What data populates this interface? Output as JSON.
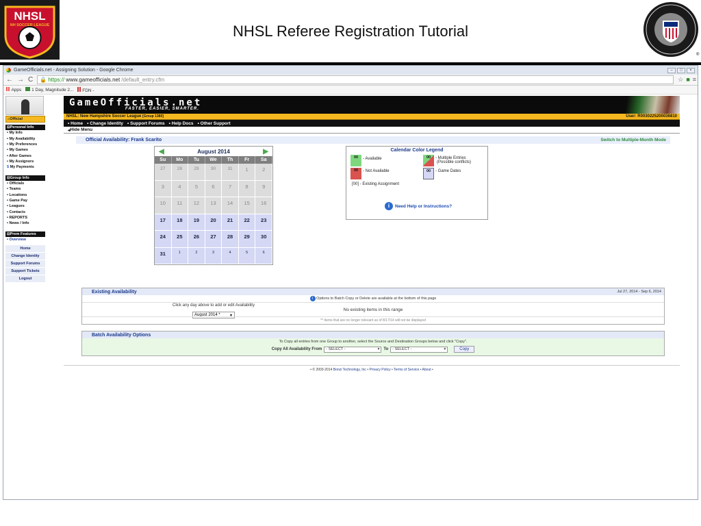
{
  "slide": {
    "title": "NHSL Referee Registration Tutorial",
    "logo_left_text": "NHSL",
    "logo_left_sub": "NH SOCCER LEAGUE",
    "logo_right_text": "U.S. SOCCER FEDERATION REFEREE PROGRAM"
  },
  "browser": {
    "window_title": "GameOfficials.net - Assigning Solution - Google Chrome",
    "url_scheme": "https://",
    "url_host": "www.gameofficials.net",
    "url_path": "/default_entry.cfm",
    "bookmarks": [
      "Apps",
      "1 Day, Magnitude 2...",
      "FDN -"
    ]
  },
  "sidebar": {
    "tab": "Official",
    "personal_head": "Personal Info",
    "personal_items": [
      "My Info",
      "My Availability",
      "My Preferences",
      "My Games",
      "After Games",
      "My Assignors",
      "My Payments"
    ],
    "group_head": "Group Info",
    "group_items": [
      "Officials",
      "Teams",
      "Locations",
      "Game Pay",
      "Leagues",
      "Contacts",
      "REPORTS",
      "News / Info"
    ],
    "prem_head": "Prem Features",
    "prem_items": [
      "Overview"
    ],
    "buttons": [
      "Home",
      "Change Identity",
      "Support Forums",
      "Support Tickets",
      "Logout"
    ]
  },
  "site": {
    "logo": "GameOfficials.net",
    "tagline": "FASTER, EASIER, SMARTER.",
    "org": "NHSL: New Hampshire Soccer League",
    "group": "[Group 1380]",
    "user": "User: R0030225200036810",
    "menu": [
      "Home",
      "Change Identity",
      "Support Forums",
      "Help Docs",
      "Other Support"
    ],
    "hide_menu": "Hide Menu"
  },
  "availability": {
    "heading": "Official Availability:  Frank Scarito",
    "switch_link": "Switch to Multiple-Month Mode"
  },
  "calendar": {
    "month": "August 2014",
    "dow": [
      "Su",
      "Mo",
      "Tu",
      "We",
      "Th",
      "Fr",
      "Sa"
    ],
    "weeks": [
      [
        {
          "d": "27",
          "t": "grey"
        },
        {
          "d": "28",
          "t": "grey"
        },
        {
          "d": "29",
          "t": "grey"
        },
        {
          "d": "30",
          "t": "grey"
        },
        {
          "d": "31",
          "t": "grey"
        },
        {
          "d": "1",
          "t": "grey cur"
        },
        {
          "d": "2",
          "t": "grey cur"
        }
      ],
      [
        {
          "d": "3",
          "t": "grey cur"
        },
        {
          "d": "4",
          "t": "grey cur"
        },
        {
          "d": "5",
          "t": "grey cur"
        },
        {
          "d": "6",
          "t": "grey cur"
        },
        {
          "d": "7",
          "t": "grey cur"
        },
        {
          "d": "8",
          "t": "grey cur"
        },
        {
          "d": "9",
          "t": "grey cur"
        }
      ],
      [
        {
          "d": "10",
          "t": "grey cur"
        },
        {
          "d": "11",
          "t": "grey cur"
        },
        {
          "d": "12",
          "t": "grey cur"
        },
        {
          "d": "13",
          "t": "grey cur"
        },
        {
          "d": "14",
          "t": "grey cur"
        },
        {
          "d": "15",
          "t": "grey cur"
        },
        {
          "d": "16",
          "t": "grey cur"
        }
      ],
      [
        {
          "d": "17",
          "t": "blue"
        },
        {
          "d": "18",
          "t": "blue"
        },
        {
          "d": "19",
          "t": "blue"
        },
        {
          "d": "20",
          "t": "blue"
        },
        {
          "d": "21",
          "t": "blue"
        },
        {
          "d": "22",
          "t": "blue"
        },
        {
          "d": "23",
          "t": "blue"
        }
      ],
      [
        {
          "d": "24",
          "t": "blue"
        },
        {
          "d": "25",
          "t": "blue"
        },
        {
          "d": "26",
          "t": "blue"
        },
        {
          "d": "27",
          "t": "blue"
        },
        {
          "d": "28",
          "t": "blue"
        },
        {
          "d": "29",
          "t": "blue"
        },
        {
          "d": "30",
          "t": "blue"
        }
      ],
      [
        {
          "d": "31",
          "t": "blue"
        },
        {
          "d": "1",
          "t": "blue small"
        },
        {
          "d": "2",
          "t": "blue small"
        },
        {
          "d": "3",
          "t": "blue small"
        },
        {
          "d": "4",
          "t": "blue small"
        },
        {
          "d": "5",
          "t": "blue small"
        },
        {
          "d": "6",
          "t": "blue small"
        }
      ]
    ],
    "hint": "Click any day above to add or edit Availability",
    "month_select": "August 2014 *"
  },
  "legend": {
    "title": "Calendar Color Legend",
    "available": "- Available",
    "not_available": "- Not Available",
    "multiple_1": "- Multiple Entries",
    "multiple_2": "(Possible conflicts)",
    "game_dates": "- Game Dates",
    "existing": "[00] - Existing Assignment",
    "swatch_label": "00",
    "help": "Need Help or Instructions?",
    "colors": {
      "available": "#7ed87e",
      "not_available": "#d9534f",
      "game_dates": "#d4d8f4"
    }
  },
  "existing": {
    "title": "Existing Availability",
    "range": "Jul 27, 2014 - Sep 6, 2014",
    "note_top": "Options to Batch Copy or Delete are available at the bottom of this page",
    "empty": "No existing items in this range",
    "note_bottom": "** Items that are no longer relevant as of  8/17/14  will not be displayed"
  },
  "batch": {
    "title": "Batch Availability Options",
    "instructions": "To Copy all entries from one Group to another, select the Source and Destination Groups below and click \"Copy\".",
    "from_label": "Copy All Availability From",
    "from_value": "- SELECT -",
    "to_label": "To",
    "to_value": "- SELECT -",
    "copy": "Copy"
  },
  "footer": {
    "copyright": "© 2003-2014",
    "company": "Bonzi Technology, Inc",
    "privacy": "Privacy Policy",
    "terms": "Terms of Service",
    "about": "About"
  }
}
